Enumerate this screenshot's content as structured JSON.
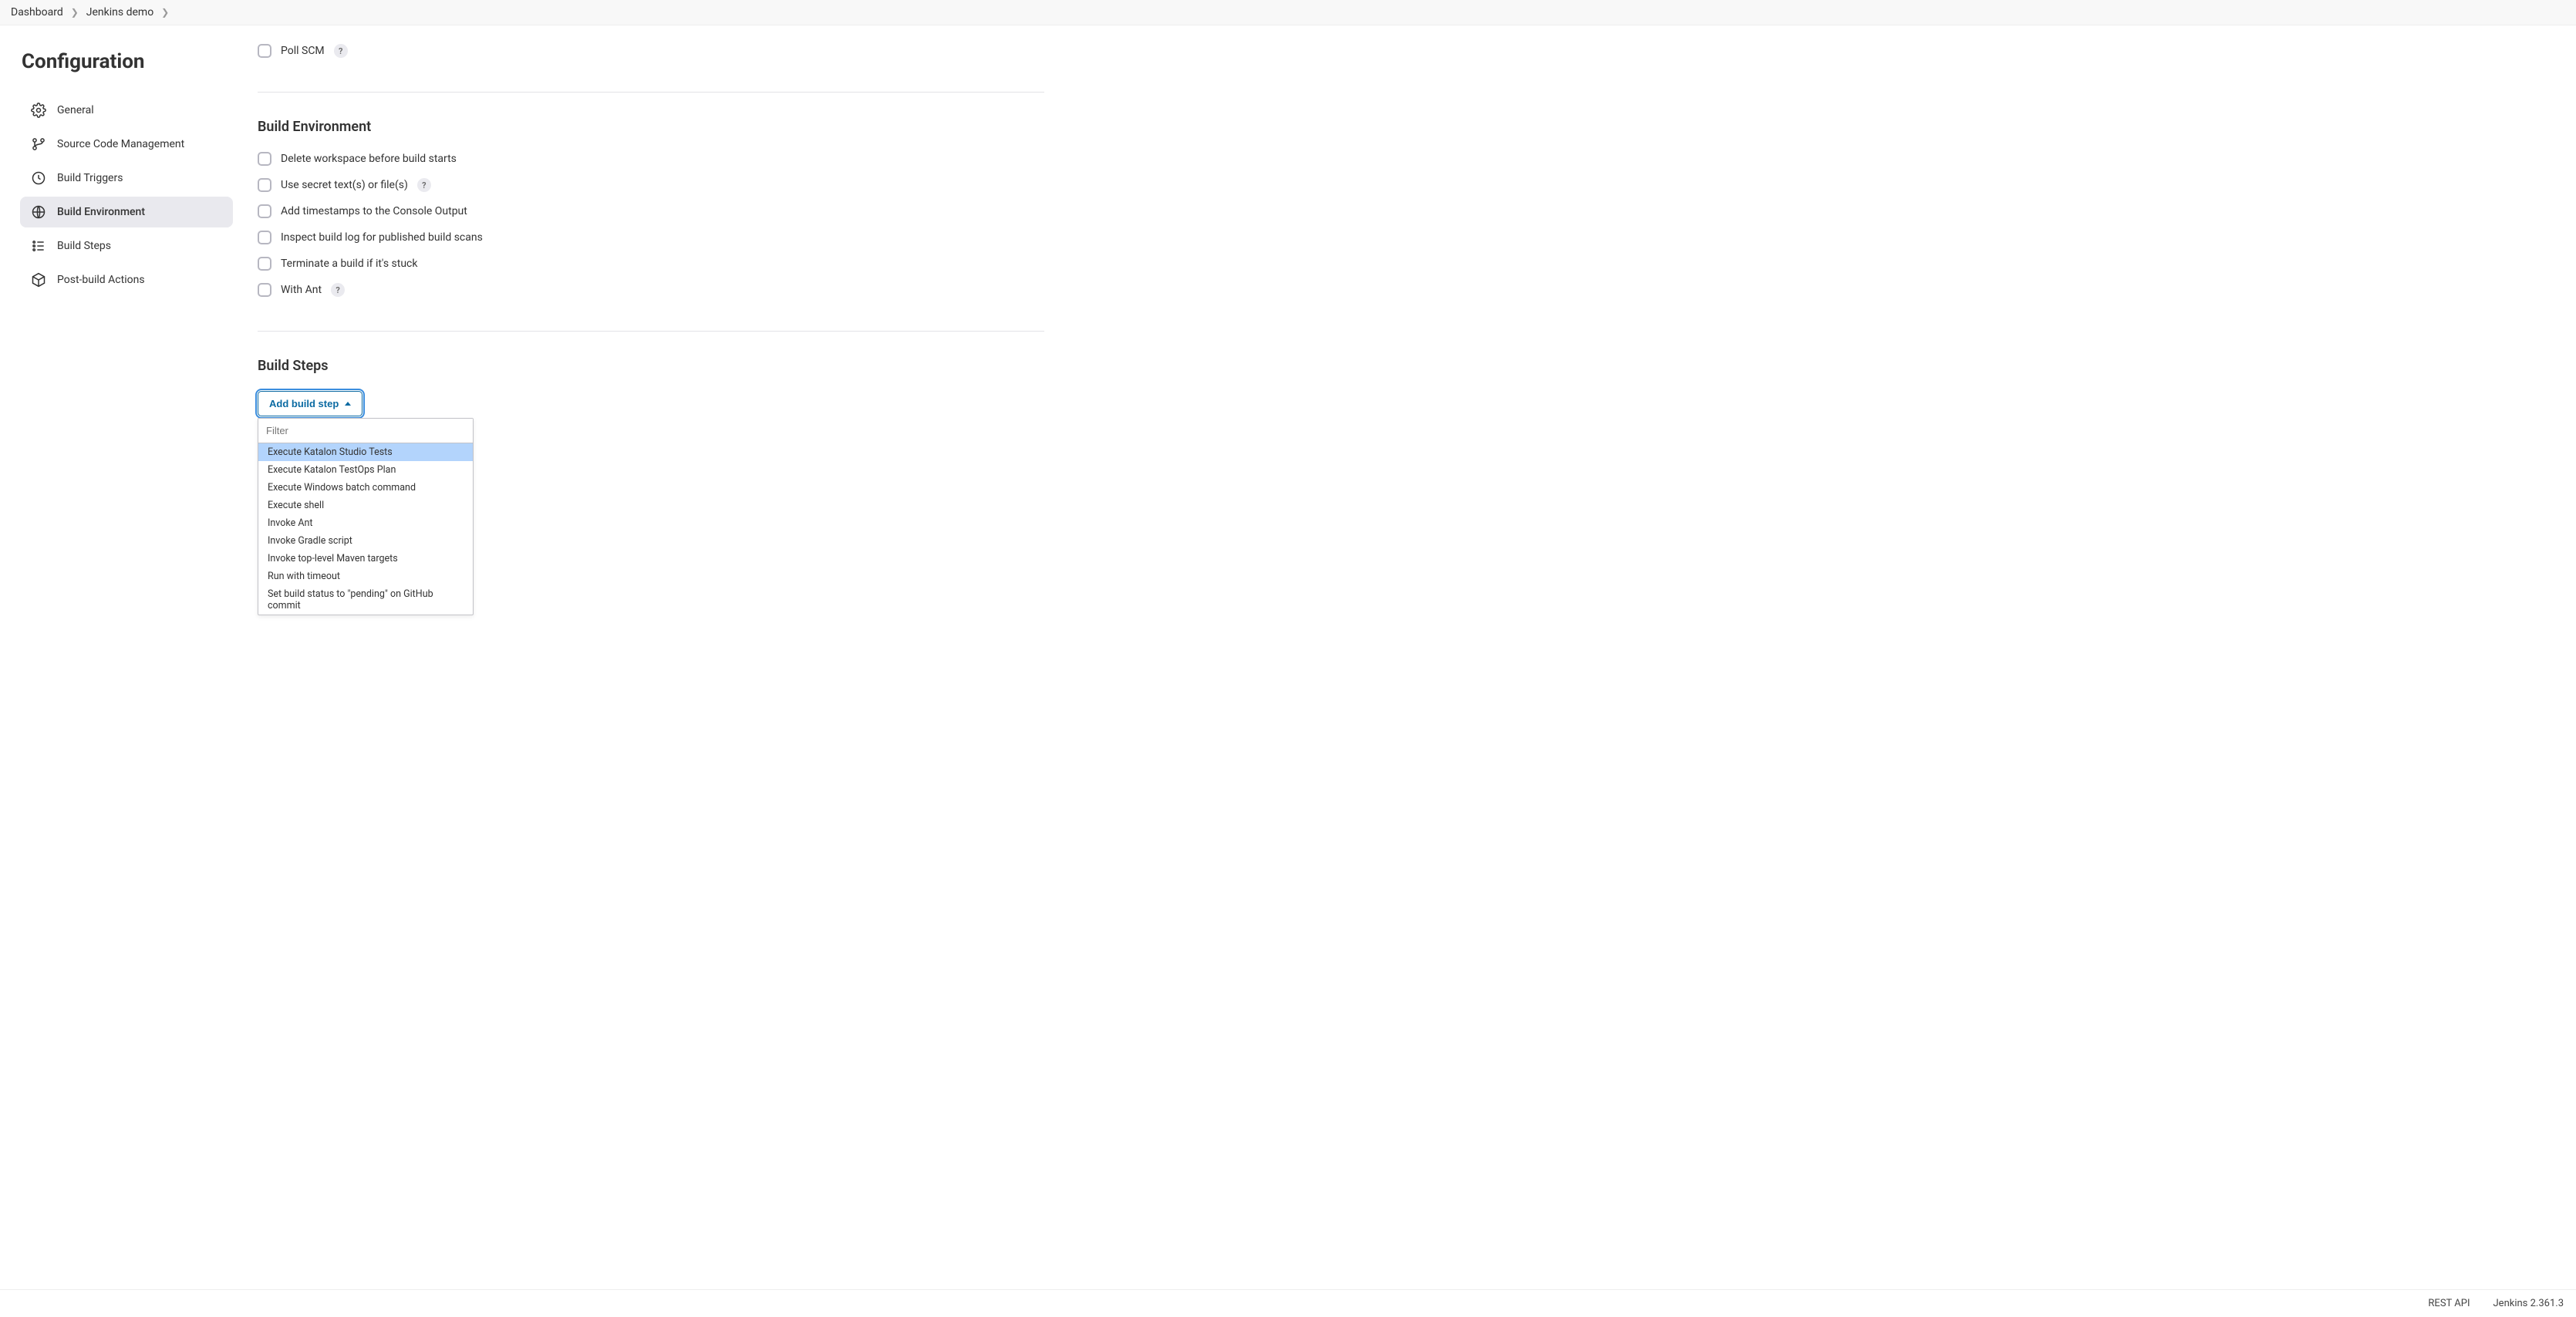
{
  "breadcrumbs": [
    {
      "label": "Dashboard"
    },
    {
      "label": "Jenkins demo"
    }
  ],
  "page_title": "Configuration",
  "sidebar": [
    {
      "label": "General",
      "icon": "gear"
    },
    {
      "label": "Source Code Management",
      "icon": "branch"
    },
    {
      "label": "Build Triggers",
      "icon": "clock"
    },
    {
      "label": "Build Environment",
      "icon": "globe",
      "active": true
    },
    {
      "label": "Build Steps",
      "icon": "steps"
    },
    {
      "label": "Post-build Actions",
      "icon": "package"
    }
  ],
  "triggers_section": {
    "poll_scm_label": "Poll SCM",
    "help": "?"
  },
  "env_section": {
    "title": "Build Environment",
    "items": [
      {
        "label": "Delete workspace before build starts",
        "help": false
      },
      {
        "label": "Use secret text(s) or file(s)",
        "help": true
      },
      {
        "label": "Add timestamps to the Console Output",
        "help": false
      },
      {
        "label": "Inspect build log for published build scans",
        "help": false
      },
      {
        "label": "Terminate a build if it's stuck",
        "help": false
      },
      {
        "label": "With Ant",
        "help": true
      }
    ],
    "help": "?"
  },
  "steps_section": {
    "title": "Build Steps",
    "button_label": "Add build step",
    "filter_placeholder": "Filter",
    "options": [
      "Execute Katalon Studio Tests",
      "Execute Katalon TestOps Plan",
      "Execute Windows batch command",
      "Execute shell",
      "Invoke Ant",
      "Invoke Gradle script",
      "Invoke top-level Maven targets",
      "Run with timeout",
      "Set build status to \"pending\" on GitHub commit"
    ],
    "highlighted_index": 0
  },
  "footer": {
    "rest_api": "REST API",
    "version": "Jenkins 2.361.3"
  }
}
